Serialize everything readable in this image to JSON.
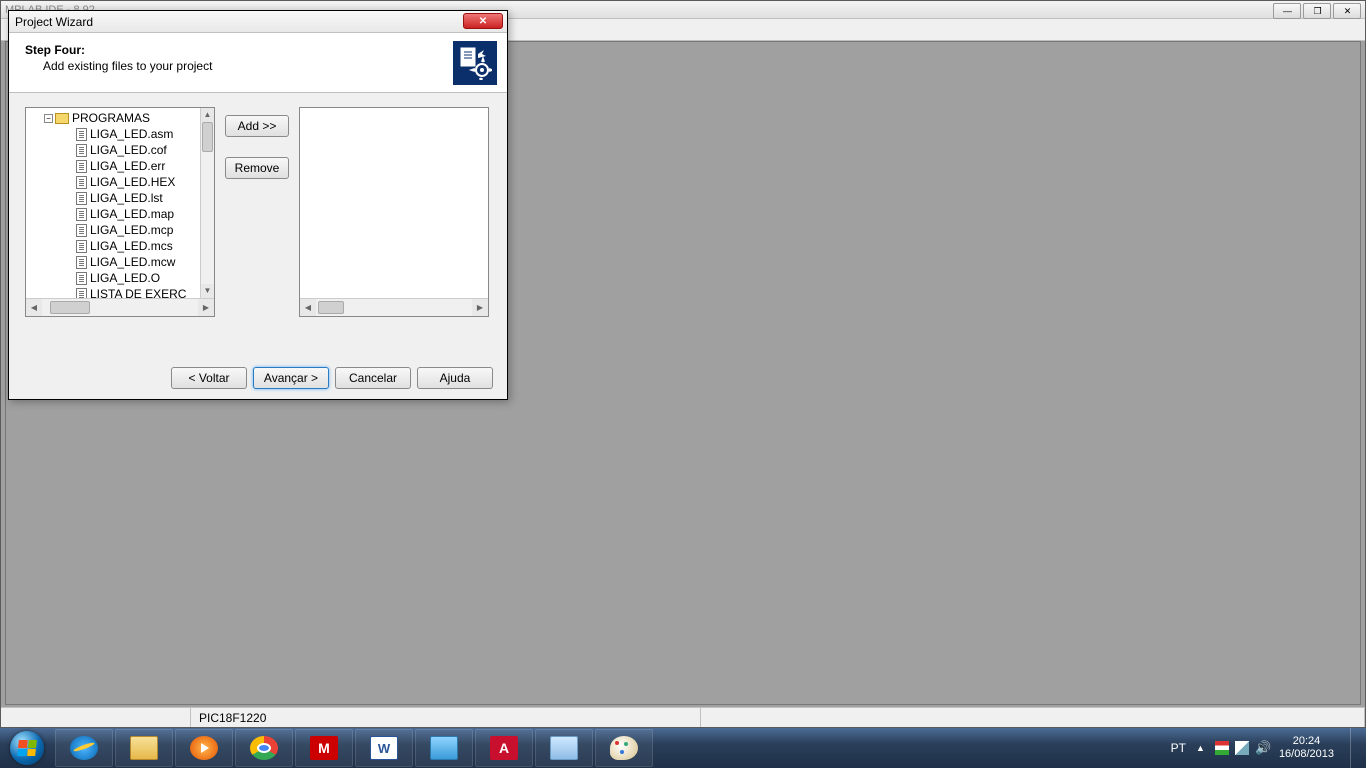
{
  "ide": {
    "title": "MPLAB IDE - 8.92",
    "status_device": "PIC18F1220"
  },
  "dialog": {
    "title": "Project Wizard",
    "step": "Step Four:",
    "subtitle": "Add existing files to your project",
    "folder": "PROGRAMAS",
    "files": [
      "LIGA_LED.asm",
      "LIGA_LED.cof",
      "LIGA_LED.err",
      "LIGA_LED.HEX",
      "LIGA_LED.lst",
      "LIGA_LED.map",
      "LIGA_LED.mcp",
      "LIGA_LED.mcs",
      "LIGA_LED.mcw",
      "LIGA_LED.O",
      "LISTA DE EXERC"
    ],
    "buttons": {
      "add": "Add >>",
      "remove": "Remove",
      "back": "< Voltar",
      "next": "Avançar >",
      "cancel": "Cancelar",
      "help": "Ajuda"
    }
  },
  "taskbar": {
    "lang": "PT",
    "time": "20:24",
    "date": "16/08/2013"
  }
}
